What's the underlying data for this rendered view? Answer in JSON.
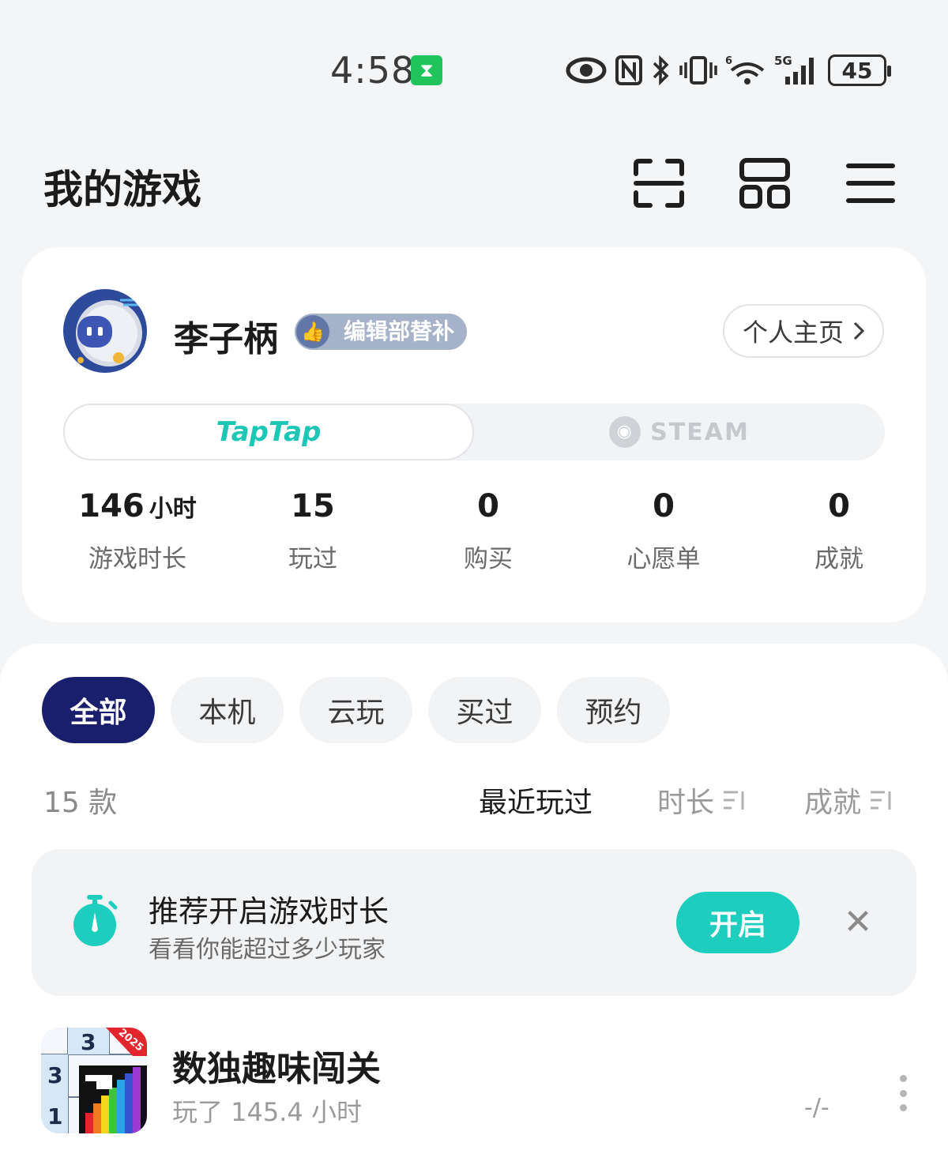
{
  "status_bar": {
    "time": "4:58",
    "signal_label": "5G",
    "wifi_label": "6",
    "battery": "45"
  },
  "header": {
    "title": "我的游戏"
  },
  "profile": {
    "username": "李子柄",
    "badge": "编辑部替补",
    "home_button": "个人主页",
    "platforms": {
      "taptap": "TapTap",
      "steam": "STEAM",
      "selected": "taptap"
    },
    "stats": [
      {
        "value": "146",
        "unit": "小时",
        "label": "游戏时长"
      },
      {
        "value": "15",
        "unit": "",
        "label": "玩过"
      },
      {
        "value": "0",
        "unit": "",
        "label": "购买"
      },
      {
        "value": "0",
        "unit": "",
        "label": "心愿单"
      },
      {
        "value": "0",
        "unit": "",
        "label": "成就"
      }
    ]
  },
  "games": {
    "filters": [
      "全部",
      "本机",
      "云玩",
      "买过",
      "预约"
    ],
    "active_filter": "全部",
    "count": "15 款",
    "sort": {
      "recent": "最近玩过",
      "duration": "时长",
      "achievement": "成就",
      "active": "recent"
    },
    "promo": {
      "title": "推荐开启游戏时长",
      "subtitle": "看看你能超过多少玩家",
      "button": "开启"
    },
    "list": [
      {
        "name": "数独趣味闯关",
        "played": "玩了 145.4 小时",
        "achievement": "-/-",
        "icon_text_a": "3",
        "icon_text_b": "3",
        "icon_text_c": "1",
        "icon_ribbon": "2025"
      }
    ]
  },
  "colors": {
    "accent_teal": "#1dcdbd",
    "active_chip": "#1a1f6d",
    "badge": "#a6b1ca"
  }
}
